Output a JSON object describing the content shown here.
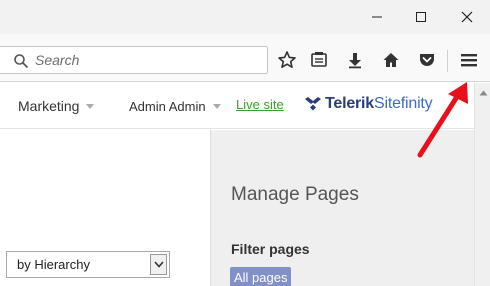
{
  "browser": {
    "search": {
      "placeholder": "Search",
      "value": ""
    },
    "toolbar_icons": [
      "bookmark-star-icon",
      "reading-list-icon",
      "download-icon",
      "home-icon",
      "pocket-icon"
    ],
    "menu_icon": "hamburger-menu-icon"
  },
  "window_controls": [
    "minimize-icon",
    "maximize-icon",
    "close-icon"
  ],
  "header": {
    "marketing_label": "Marketing",
    "user_label": "Admin Admin",
    "live_site_label": "Live site",
    "logo_brand": "Telerik",
    "logo_product": "Sitefinity"
  },
  "content": {
    "hierarchy_select_value": "by Hierarchy",
    "panel_title": "Manage Pages",
    "filter_title": "Filter pages",
    "all_pages_label": "All pages"
  },
  "colors": {
    "annotation_arrow": "#e8101c",
    "live_site_link": "#36a130",
    "logo_dark": "#2a3e7c",
    "logo_light": "#3e6bc5",
    "all_pages_bg": "#8190c6"
  }
}
